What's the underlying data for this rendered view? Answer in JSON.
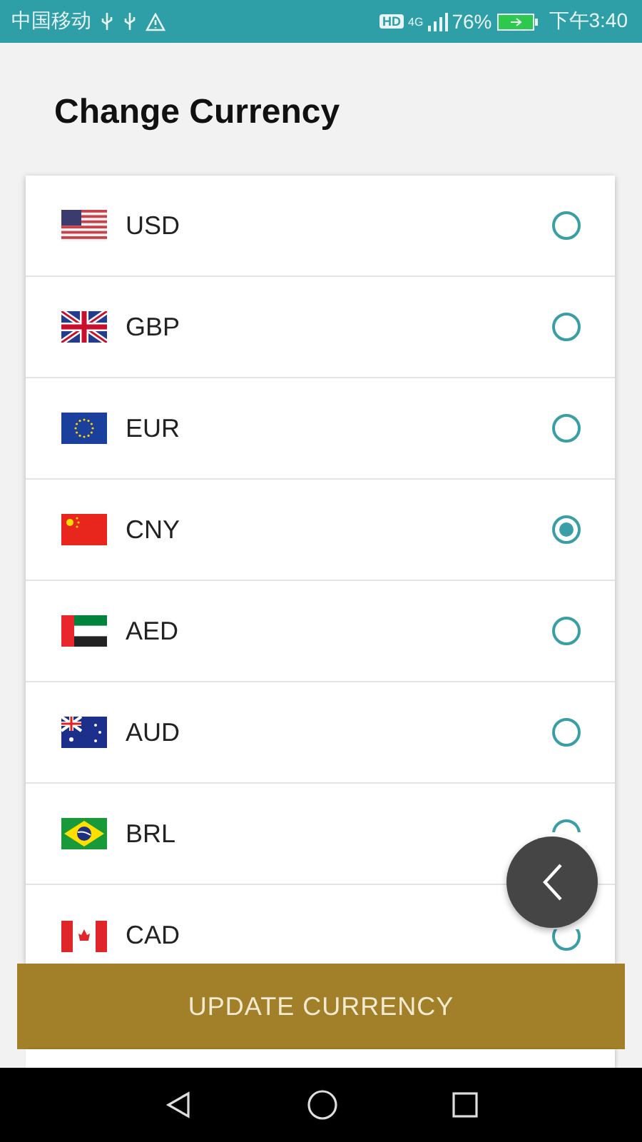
{
  "status_bar": {
    "carrier": "中国移动",
    "hd": "HD",
    "network": "4G",
    "battery": "76%",
    "time": "下午3:40"
  },
  "title": "Change Currency",
  "currencies": [
    {
      "code": "USD",
      "selected": false
    },
    {
      "code": "GBP",
      "selected": false
    },
    {
      "code": "EUR",
      "selected": false
    },
    {
      "code": "CNY",
      "selected": true
    },
    {
      "code": "AED",
      "selected": false
    },
    {
      "code": "AUD",
      "selected": false
    },
    {
      "code": "BRL",
      "selected": false
    },
    {
      "code": "CAD",
      "selected": false
    }
  ],
  "update_button": "UPDATE CURRENCY"
}
